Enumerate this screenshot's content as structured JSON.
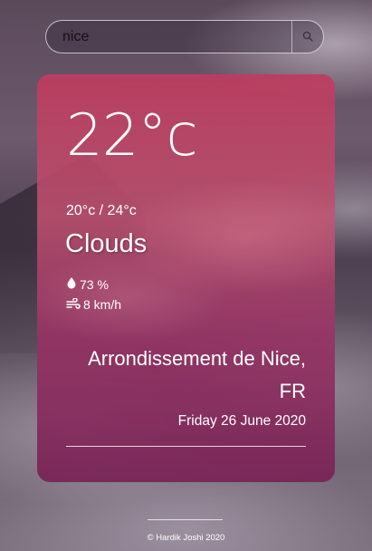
{
  "search": {
    "value": "nice",
    "placeholder": ""
  },
  "weather": {
    "temperature": "22°c",
    "range": "20°c / 24°c",
    "condition": "Clouds",
    "humidity": "73 %",
    "wind": "8 km/h"
  },
  "location": {
    "city": "Arrondissement de Nice, FR",
    "date": "Friday 26 June 2020"
  },
  "footer": {
    "text": "© Hardik Joshi 2020"
  },
  "icons": {
    "search": "search-icon",
    "humidity": "water-drop-icon",
    "wind": "wind-icon"
  },
  "colors": {
    "card_top": "#be3c5f",
    "card_bottom": "#782355",
    "text": "#ffffff"
  }
}
